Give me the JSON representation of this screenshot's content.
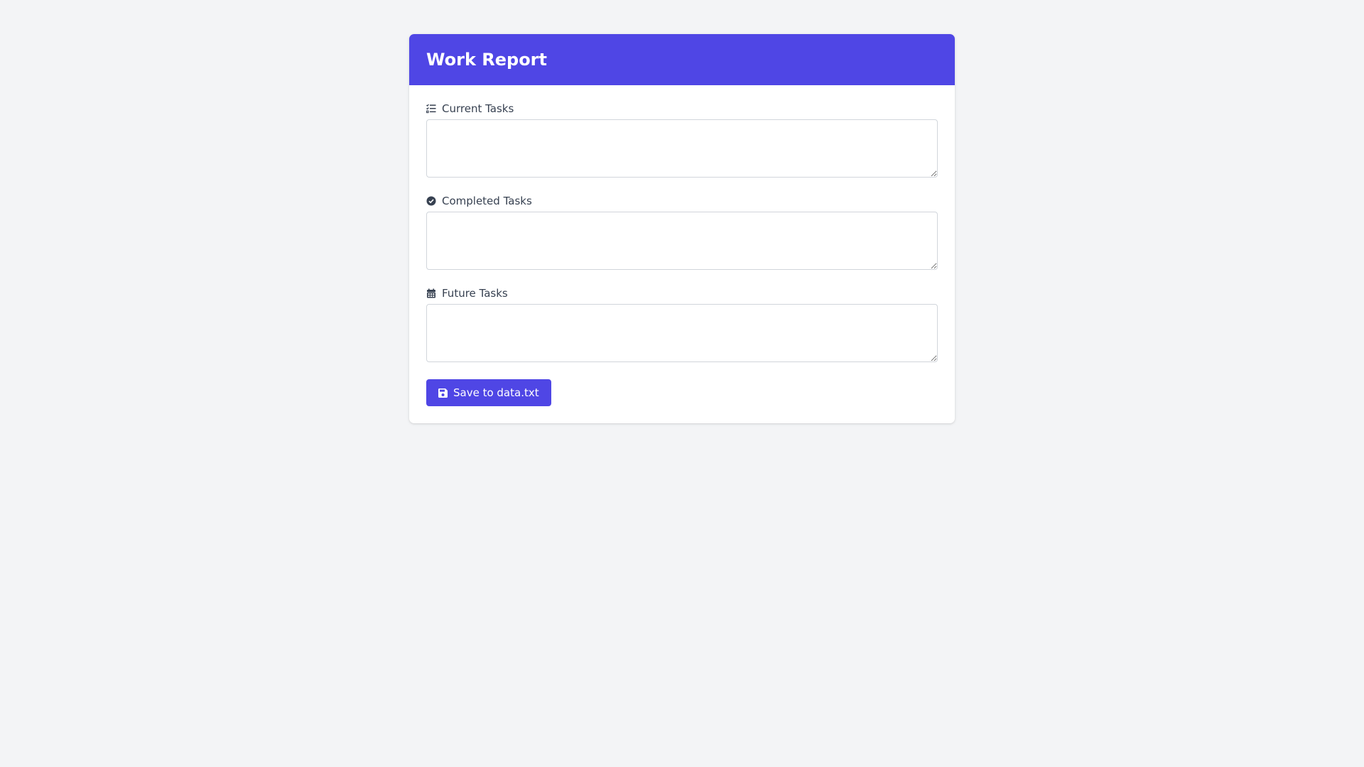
{
  "header": {
    "title": "Work Report"
  },
  "fields": [
    {
      "label": "Current Tasks",
      "icon": "task-list-icon",
      "value": "",
      "placeholder": ""
    },
    {
      "label": "Completed Tasks",
      "icon": "circle-check-icon",
      "value": "",
      "placeholder": ""
    },
    {
      "label": "Future Tasks",
      "icon": "calendar-icon",
      "value": "",
      "placeholder": ""
    }
  ],
  "actions": {
    "save_label": "Save to data.txt",
    "save_icon": "floppy-disk-icon"
  },
  "colors": {
    "accent": "#4f46e5",
    "background": "#f3f4f6",
    "label_text": "#374151"
  }
}
